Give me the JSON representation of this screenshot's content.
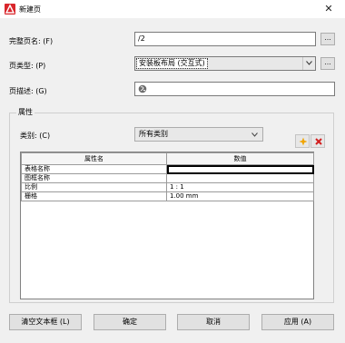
{
  "window": {
    "title": "新建页",
    "close_glyph": "✕",
    "brand_color": "#d9262c"
  },
  "form": {
    "full_name": {
      "label": "完整页名: (F)",
      "value": "/2",
      "button": "..."
    },
    "page_type": {
      "label": "页类型: (P)",
      "value": "安装板布局 (交互式)",
      "button": "..."
    },
    "page_desc": {
      "label": "页描述: (G)",
      "value": ""
    }
  },
  "properties": {
    "group_title": "属性",
    "category": {
      "label": "类别: (C)",
      "value": "所有类别"
    },
    "add_icon": "star-add-icon",
    "delete_icon": "delete-x-icon",
    "table": {
      "columns": [
        "属性名",
        "数值"
      ],
      "rows": [
        [
          "表格名称",
          ""
        ],
        [
          "图框名称",
          ""
        ],
        [
          "比例",
          "1 : 1"
        ],
        [
          "栅格",
          "1.00 mm"
        ]
      ]
    }
  },
  "buttons": {
    "clear": "清空文本框 (L)",
    "ok": "确定",
    "cancel": "取消",
    "apply": "应用 (A)"
  }
}
